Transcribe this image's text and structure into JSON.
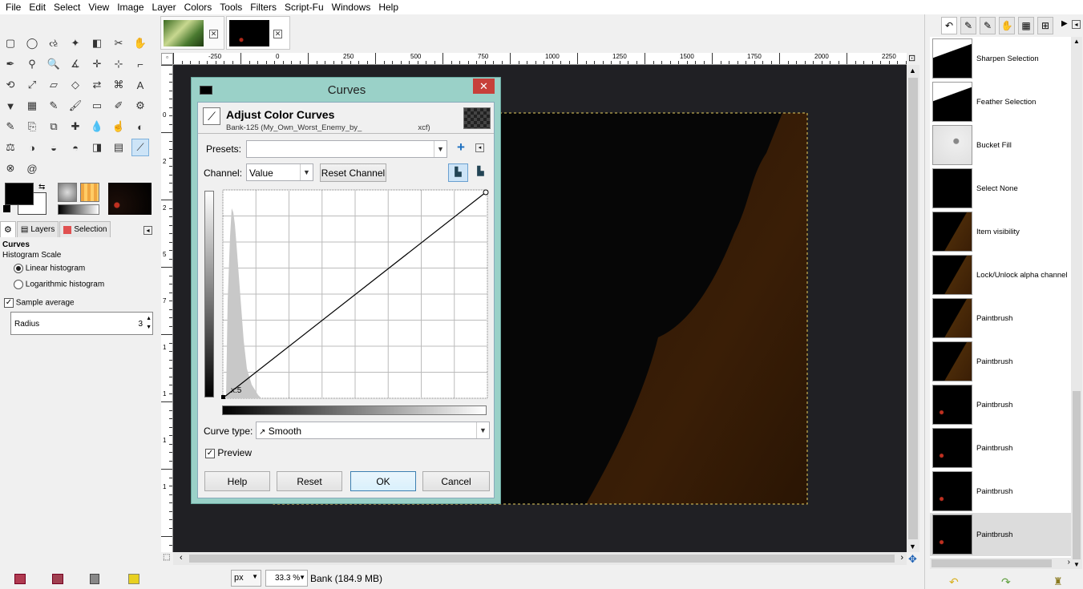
{
  "menu": [
    "File",
    "Edit",
    "Select",
    "View",
    "Image",
    "Layer",
    "Colors",
    "Tools",
    "Filters",
    "Script-Fu",
    "Windows",
    "Help"
  ],
  "left_tabs": {
    "layers": "Layers",
    "selection": "Selection"
  },
  "tool_options": {
    "title": "Curves",
    "histogram_scale": "Histogram Scale",
    "linear": "Linear histogram",
    "logarithmic": "Logarithmic histogram",
    "sample_average": "Sample average",
    "radius_label": "Radius",
    "radius_value": "3"
  },
  "ruler_top_labels": [
    "-250",
    "0",
    "250",
    "500",
    "750",
    "1000",
    "1250",
    "1500",
    "1750",
    "2000",
    "2250"
  ],
  "ruler_left_labels": [
    "0",
    "2",
    "2",
    "5",
    "7",
    "1",
    "1",
    "1",
    "1"
  ],
  "dialog": {
    "title": "Curves",
    "heading": "Adjust Color Curves",
    "subtitle": "Bank-125 (My_Own_Worst_Enemy_by_",
    "subtitle_ext": "xcf)",
    "presets_label": "Presets:",
    "presets_value": "",
    "channel_label": "Channel:",
    "channel_value": "Value",
    "reset_channel": "Reset Channel",
    "coord_readout": "x:5",
    "curve_type_label": "Curve type:",
    "curve_type_value": "Smooth",
    "preview_label": "Preview",
    "help": "Help",
    "reset": "Reset",
    "ok": "OK",
    "cancel": "Cancel"
  },
  "status": {
    "unit": "px",
    "zoom": "33.3 %",
    "info": "Bank (184.9 MB)"
  },
  "undo_history": [
    {
      "label": "Sharpen Selection",
      "thumb": "white-shape"
    },
    {
      "label": "Feather Selection",
      "thumb": "white-shape"
    },
    {
      "label": "Bucket Fill",
      "thumb": "light-sketch"
    },
    {
      "label": "Select None",
      "thumb": "black"
    },
    {
      "label": "Item visibility",
      "thumb": "dark-orange"
    },
    {
      "label": "Lock/Unlock alpha channel",
      "thumb": "dark-orange"
    },
    {
      "label": "Paintbrush",
      "thumb": "dark-orange"
    },
    {
      "label": "Paintbrush",
      "thumb": "dark-orange"
    },
    {
      "label": "Paintbrush",
      "thumb": "dark"
    },
    {
      "label": "Paintbrush",
      "thumb": "dark"
    },
    {
      "label": "Paintbrush",
      "thumb": "dark"
    },
    {
      "label": "Paintbrush",
      "thumb": "dark"
    }
  ],
  "colors": {
    "dialog_frame": "#9ad1c8",
    "canvas_bg": "#202024",
    "close_btn": "#c7403a"
  }
}
